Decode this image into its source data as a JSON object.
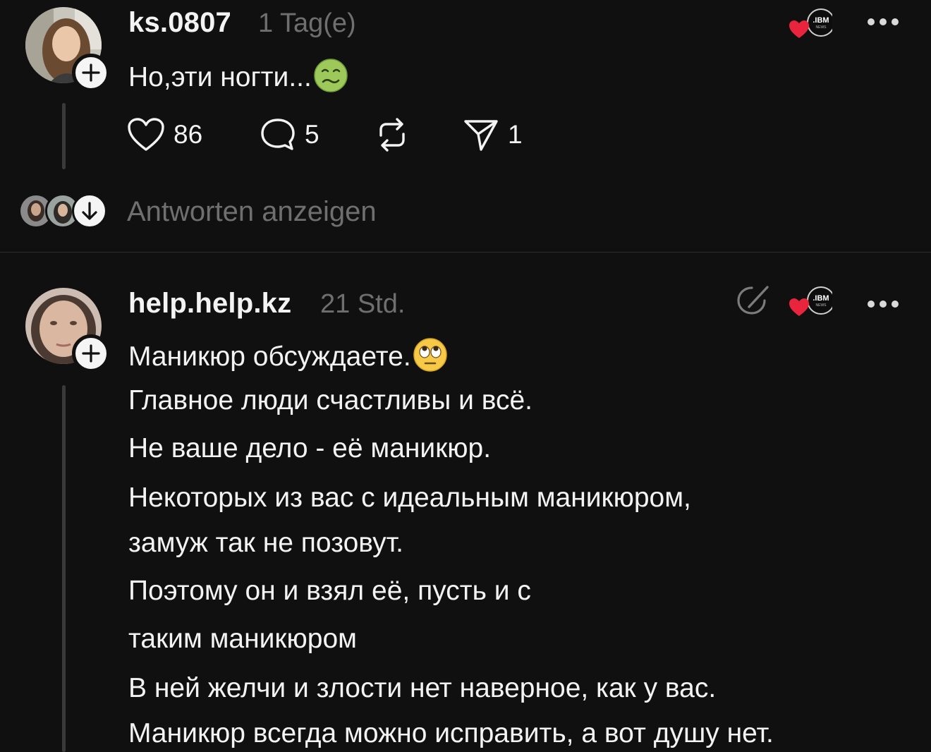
{
  "post1": {
    "username": "ks.0807",
    "timestamp": "1 Tag(e)",
    "text": "Но,эти ногти...",
    "emoji": "nauseated-face-emoji",
    "likes": "86",
    "comments": "5",
    "shares": "1",
    "replies_label": "Antworten anzeigen",
    "badge": ".IBM"
  },
  "post2": {
    "username": "help.help.kz",
    "timestamp": "21 Std.",
    "badge": ".IBM",
    "emoji": "rolling-eyes-emoji",
    "lines": [
      "Маникюр обсуждаете.",
      "Главное люди счастливы и всё.",
      "Не ваше дело - её маникюр.",
      "Некоторых из вас с идеальным маникюром,",
      "замуж так не позовут.",
      "Поэтому он и взял её, пусть и с",
      "таким маникюром",
      "В ней желчи и злости нет наверное, как у вас.",
      "Маникюр всегда можно исправить, а вот душу нет."
    ]
  },
  "colors": {
    "background": "#101010",
    "text": "#f3f3f3",
    "muted": "#6f6f6f",
    "heart": "#e8253c",
    "divider": "#2c2c2c"
  }
}
